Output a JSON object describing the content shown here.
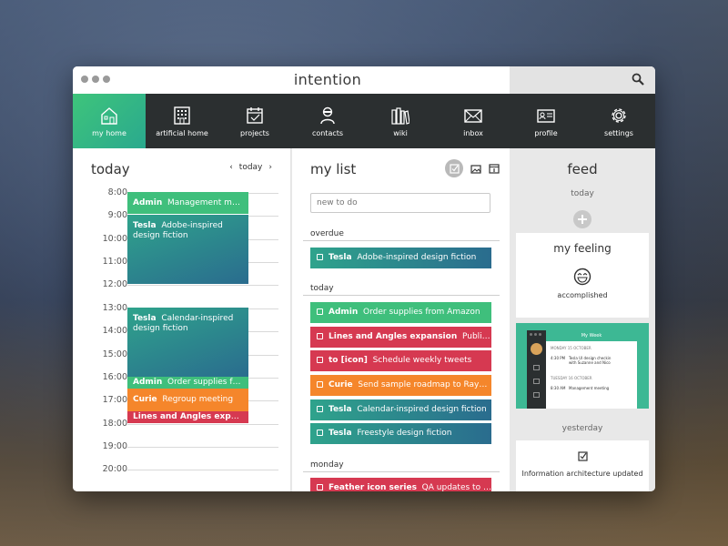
{
  "window": {
    "title": "intention"
  },
  "nav": {
    "items": [
      {
        "label": "my home",
        "icon": "home-icon",
        "active": true
      },
      {
        "label": "artificial home",
        "icon": "building-icon"
      },
      {
        "label": "projects",
        "icon": "calendar-icon"
      },
      {
        "label": "contacts",
        "icon": "person-icon"
      },
      {
        "label": "wiki",
        "icon": "books-icon"
      },
      {
        "label": "inbox",
        "icon": "envelope-icon"
      },
      {
        "label": "profile",
        "icon": "id-card-icon"
      },
      {
        "label": "settings",
        "icon": "gear-icon"
      }
    ]
  },
  "today": {
    "title": "today",
    "nav_label": "today",
    "prev": "‹",
    "next": "›",
    "hours": [
      "8:00",
      "9:00",
      "10:00",
      "11:00",
      "12:00",
      "13:00",
      "14:00",
      "15:00",
      "16:00",
      "17:00",
      "18:00",
      "19:00",
      "20:00"
    ],
    "events": [
      {
        "project": "Admin",
        "text": "Management mee..."
      },
      {
        "project": "Tesla",
        "text": "Adobe-inspired design fiction"
      },
      {
        "project": "Tesla",
        "text": "Calendar-inspired design fiction"
      },
      {
        "project": "Admin",
        "text": "Order supplies fro..."
      },
      {
        "project": "Curie",
        "text": "Regroup meeting"
      },
      {
        "project": "Lines and Angles expans",
        "text": "..."
      }
    ]
  },
  "list": {
    "title": "my list",
    "new_todo_placeholder": "new to do",
    "sections": {
      "overdue": "overdue",
      "today": "today",
      "monday": "monday"
    },
    "overdue": [
      {
        "project": "Tesla",
        "text": "Adobe-inspired design fiction"
      }
    ],
    "today_tasks": [
      {
        "project": "Admin",
        "text": "Order supplies from Amazon"
      },
      {
        "project": "Lines and Angles expansion",
        "text": "Publish Li..."
      },
      {
        "project": "to [icon]",
        "text": "Schedule weekly tweets"
      },
      {
        "project": "Curie",
        "text": "Send sample roadmap to Raymo..."
      },
      {
        "project": "Tesla",
        "text": "Calendar-inspired design fiction"
      },
      {
        "project": "Tesla",
        "text": "Freestyle design fiction"
      }
    ],
    "monday_tasks": [
      {
        "project": "Feather icon series",
        "text": "QA updates to Fea..."
      }
    ]
  },
  "feed": {
    "title": "feed",
    "today_label": "today",
    "yesterday_label": "yesterday",
    "feeling_title": "my feeling",
    "feeling_value": "accomplished",
    "shot": {
      "header": "My Week",
      "day1": "MONDAY  15 OCTOBER",
      "time1": "4:30 PM",
      "item1": "Tesla UI design checkin with Suzanne and Nico",
      "day2": "TUESDAY  16 OCTOBER",
      "time2": "8:30 AM",
      "item2": "Management meeting"
    },
    "info_title": "Information architecture updated"
  },
  "colors": {
    "accent_green": "#3fbf7c",
    "teal": "#2a6c8e",
    "red": "#d63951",
    "orange": "#f5862b",
    "nav_bg": "#2b2f30"
  }
}
